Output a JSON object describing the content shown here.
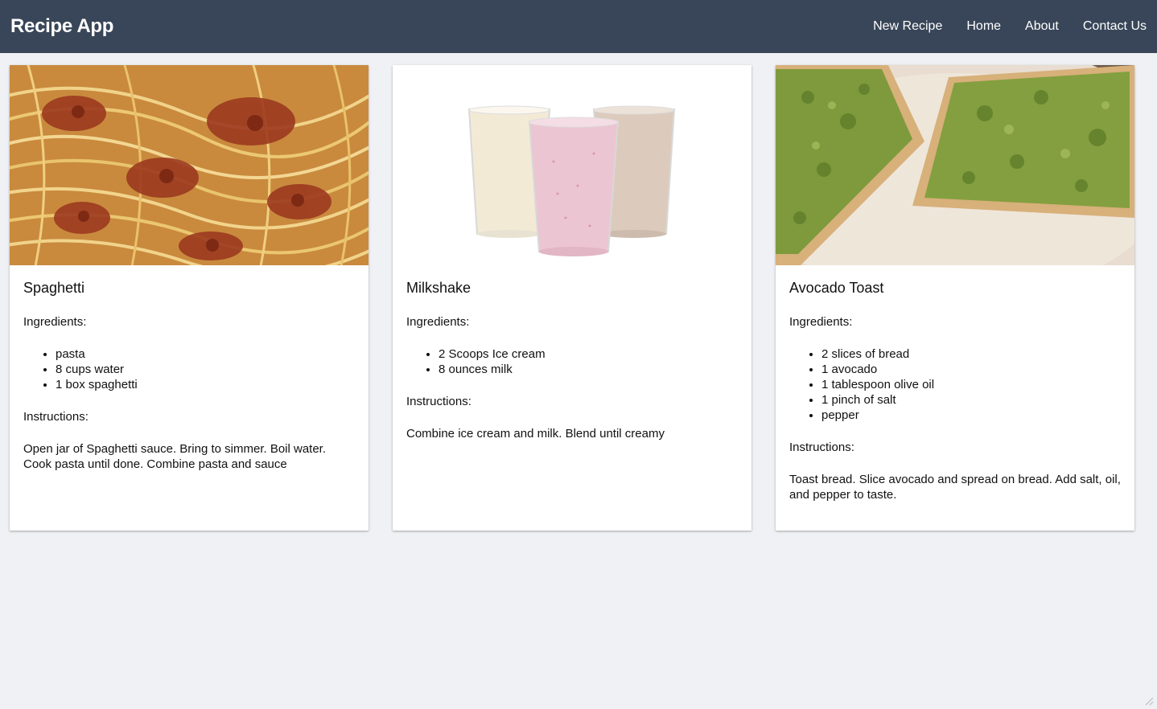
{
  "app": {
    "title": "Recipe App"
  },
  "nav": [
    {
      "label": "New Recipe"
    },
    {
      "label": "Home"
    },
    {
      "label": "About"
    },
    {
      "label": "Contact Us"
    }
  ],
  "recipes": [
    {
      "title": "Spaghetti",
      "image": "spaghetti-photo",
      "ingredients_label": "Ingredients:",
      "ingredients": [
        "pasta",
        "8 cups water",
        "1 box spaghetti"
      ],
      "instructions_label": "Instructions:",
      "instructions": "Open jar of Spaghetti sauce. Bring to simmer. Boil water. Cook pasta until done. Combine pasta and sauce"
    },
    {
      "title": "Milkshake",
      "image": "milkshake-photo",
      "ingredients_label": "Ingredients:",
      "ingredients": [
        "2 Scoops Ice cream",
        "8 ounces milk"
      ],
      "instructions_label": "Instructions:",
      "instructions": "Combine ice cream and milk. Blend until creamy"
    },
    {
      "title": "Avocado Toast",
      "image": "avocado-toast-photo",
      "ingredients_label": "Ingredients:",
      "ingredients": [
        "2 slices of bread",
        "1 avocado",
        "1 tablespoon olive oil",
        "1 pinch of salt",
        "pepper"
      ],
      "instructions_label": "Instructions:",
      "instructions": "Toast bread. Slice avocado and spread on bread. Add salt, oil, and pepper to taste."
    }
  ],
  "colors": {
    "navbar": "#394659",
    "background": "#f0f1f4",
    "card": "#ffffff"
  }
}
